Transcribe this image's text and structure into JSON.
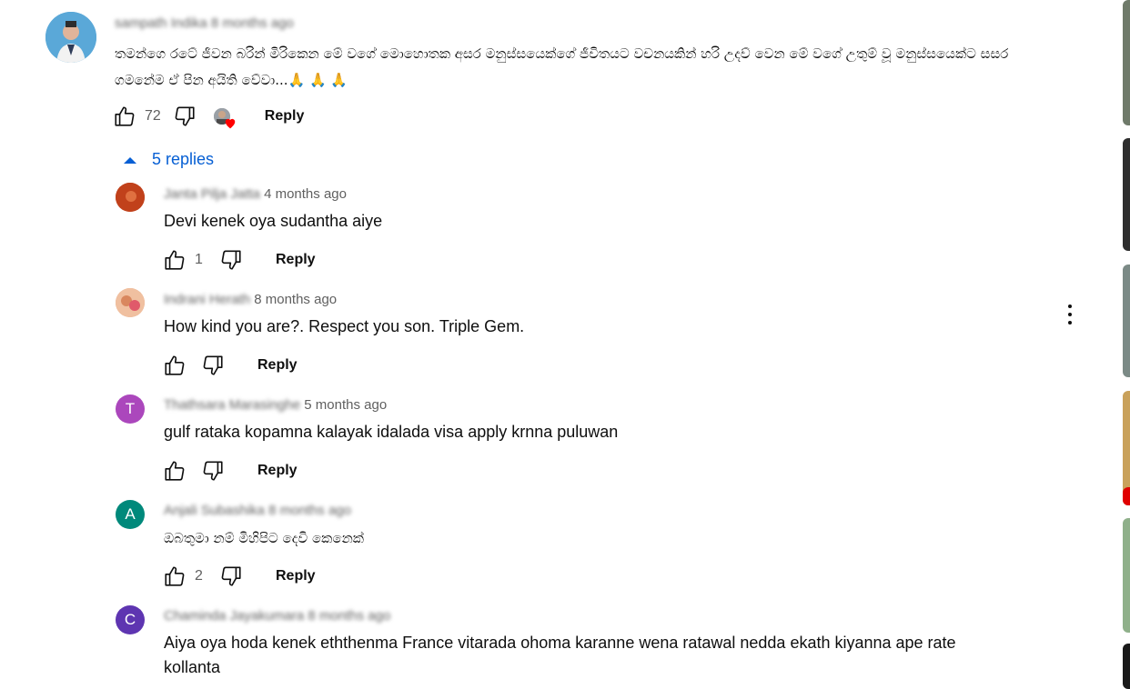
{
  "comment": {
    "author": "sampath Indika",
    "time": "8 months ago",
    "text": "තමන්ගෙ රටේ ජීවන බරින් මිරිකෙන මේ වගේ මොහොතක  අසර මනුස්සයෙක්ගේ ජීවිතයට වචනයකින් හරි උදව් වෙන මේ වගේ උතුම් වූ මනුස්සයෙක්ට සසර ගමනේම ඒ පින අයිති වේවා...🙏 🙏 🙏",
    "likes": "72",
    "reply_label": "Reply"
  },
  "replies_toggle": {
    "label": "5 replies",
    "color": "#065fd4"
  },
  "replies": [
    {
      "author": "Janta Pilja Jatta",
      "time": "4 months ago",
      "text": "Devi kenek oya sudantha aiye",
      "likes": "1",
      "reply_label": "Reply",
      "avatar_color": "#c1411b"
    },
    {
      "author": "Indrani Herath",
      "time": "8 months ago",
      "text": "How kind you are?. Respect you  son.  Triple Gem.",
      "likes": "",
      "reply_label": "Reply",
      "avatar_color": "#e8a07a"
    },
    {
      "author": "Thathsara Marasinghe",
      "time": "5 months ago",
      "text": "gulf rataka kopamna kalayak idalada visa apply krnna puluwan",
      "likes": "",
      "reply_label": "Reply",
      "avatar_letter": "T",
      "avatar_color": "#ab47bc"
    },
    {
      "author": "Anjali Subashika",
      "time": "8 months ago",
      "text": "ඔබතුමා නම් මිහිපිට  දෙවි කෙනෙක්",
      "likes": "2",
      "reply_label": "Reply",
      "avatar_letter": "A",
      "avatar_color": "#00897b"
    },
    {
      "author": "Chaminda Jayakumara",
      "time": "8 months ago",
      "text": "Aiya oya hoda kenek eththenma France vitarada ohoma karanne wena ratawal nedda ekath kiyanna ape rate kollanta",
      "avatar_letter": "C",
      "avatar_color": "#5e35b1"
    }
  ]
}
